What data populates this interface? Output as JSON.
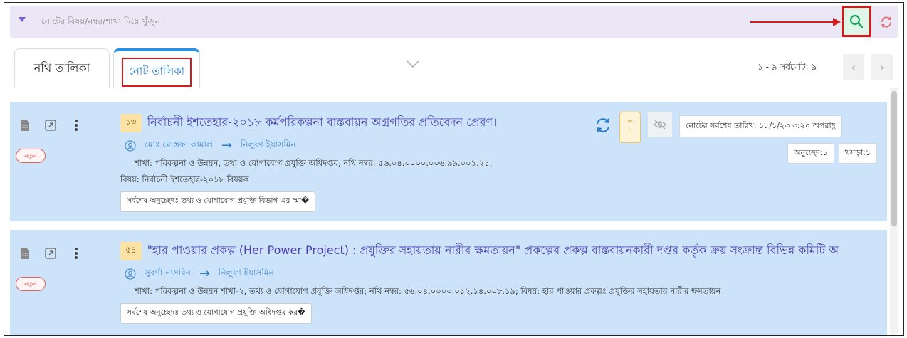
{
  "search": {
    "placeholder": "নোটের বিষয়/নম্বর/শাখা দিয়ে খুঁজুন"
  },
  "tabs": [
    {
      "label": "নথি তালিকা",
      "active": false
    },
    {
      "label": "নোট তালিকা",
      "active": true
    }
  ],
  "pagination": {
    "summary": "১ - ৯ সর্বমোট: ৯"
  },
  "colors": {
    "accent": "#2a91e0",
    "highlight": "#d31b1b",
    "card_bg": "#cde3f9",
    "title": "#4a3fb5"
  },
  "notes": [
    {
      "number": "১৩",
      "title": "নির্বাচনী ইশতেহার-২০১৮ কর্মপরিকল্পনা বাস্তবায়ন অগ্রগতির প্রতিবেদন প্রেরণ।",
      "from": "মোঃ মোস্তফা কামাল",
      "to": "নিলুফা ইয়াসমিন",
      "meta": "শাখা: পরিকল্পনা ও উন্নয়ন, তথ্য ও যোগাযোগ প্রযুক্তি অধিদপ্তর; নথি নম্বর: ৫৬.০৪.০০০০.০০৬.৯৯.০০১.২১;",
      "subject": "বিষয়: নির্বাচনী ইশতেহার-২০১৮ বিষয়ক",
      "last_para": "সর্বশেষ অনুচ্ছেদঃ তথ্য ও যোগাযোগ প্রযুক্তি বিভাগ এর স্মা�",
      "new_label": "নতুন",
      "attachment_count": "১",
      "last_date": "নোটের সর্বশেষ তারিখ: ১৮/১/২৩ ৩:২০ অপরাহ্ণ",
      "onucched": "অনুচ্ছেদ:১",
      "khosra": "খসড়া:১"
    },
    {
      "number": "৫৪",
      "title": "\"হার পাওয়ার প্রকল্প (Her Power Project) : প্রযুক্তির সহায়তায় নারীর ক্ষমতায়ন\" প্রকল্পের প্রকল্প বাস্তবায়নকারী দপ্তর কর্তৃক ক্রয় সংক্রান্ত বিভিন্ন কমিটি অ",
      "from": "সুবর্ণা নাসরিন",
      "to": "নিলুফা ইয়াসমিন",
      "meta": "শাখা: পরিকল্পনা ও উন্নয়ন শাখা-২, তথ্য ও যোগাযোগ প্রযুক্তি অধিদপ্তর; নথি নম্বর: ৫৬.০৪.০০০০.০১২.১৪.০০৮.১৯; বিষয়: হার পাওয়ার প্রকল্পঃ প্রযুক্তির সহায়তায় নারীর ক্ষমতায়ন",
      "last_para": "সর্বশেষ অনুচ্ছেদঃ তথ্য ও যোগাযোগ প্রযুক্তি অধিদপ্তর কর�",
      "new_label": "নতুন"
    }
  ]
}
